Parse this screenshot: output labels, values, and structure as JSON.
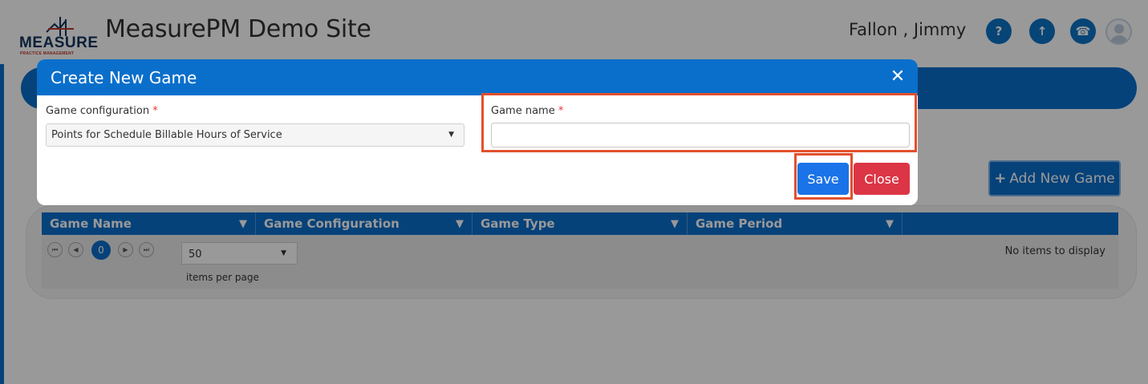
{
  "header": {
    "logo_word": "MEASURE",
    "logo_sub": "PRACTICE MANAGEMENT",
    "site_title": "MeasurePM Demo Site",
    "user_name": "Fallon , Jimmy",
    "icons": [
      "help-icon",
      "upload-icon",
      "phone-icon",
      "avatar-icon"
    ],
    "help_glyph": "?",
    "upload_glyph": "↑",
    "phone_glyph": "☎"
  },
  "page": {
    "add_game_label": "Add New Game",
    "add_game_plus": "+",
    "grid": {
      "columns": [
        {
          "label": "Game Name"
        },
        {
          "label": "Game Configuration"
        },
        {
          "label": "Game Type"
        },
        {
          "label": "Game Period"
        }
      ],
      "current_page": "0",
      "page_size": "50",
      "items_per_page_label": "items per page",
      "empty_message": "No items to display"
    }
  },
  "modal": {
    "title": "Create New Game",
    "close_glyph": "✕",
    "config_label": "Game configuration",
    "config_value": "Points for Schedule Billable Hours of Service",
    "name_label": "Game name",
    "name_value": "",
    "required_marker": "*",
    "save_label": "Save",
    "close_label": "Close"
  },
  "colors": {
    "primary": "#0a6fcb",
    "danger": "#dc3545",
    "save": "#1a73e8",
    "highlight": "#e2502d",
    "required": "#e53935"
  }
}
